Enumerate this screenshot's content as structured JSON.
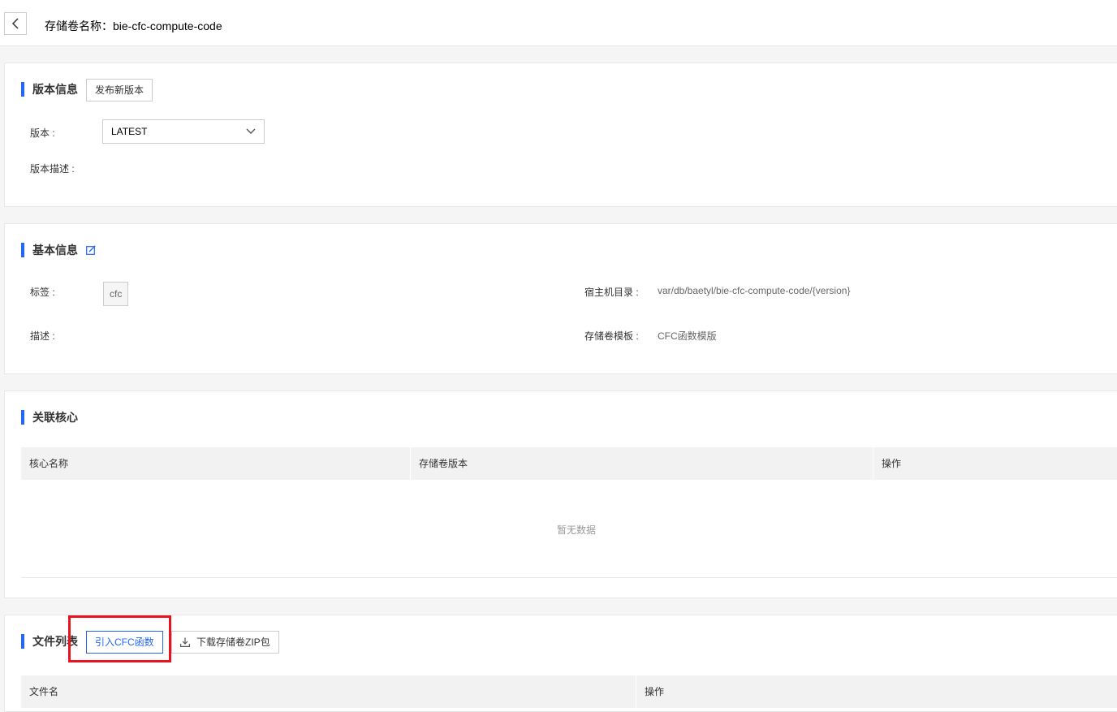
{
  "header": {
    "title": "存储卷名称：bie-cfc-compute-code"
  },
  "version_section": {
    "title": "版本信息",
    "publish_button": "发布新版本",
    "version_label": "版本 :",
    "version_value": "LATEST",
    "description_label": "版本描述 :"
  },
  "basic_section": {
    "title": "基本信息",
    "tag_label": "标签 :",
    "tag_value": "cfc",
    "description_label": "描述 :",
    "host_dir_label": "宿主机目录 :",
    "host_dir_value": "var/db/baetyl/bie-cfc-compute-code/{version}",
    "template_label": "存储卷模板 :",
    "template_value": "CFC函数模版"
  },
  "core_section": {
    "title": "关联核心",
    "columns": [
      "核心名称",
      "存储卷版本",
      "操作"
    ],
    "empty_text": "暂无数据"
  },
  "file_section": {
    "title": "文件列表",
    "import_button": "引入CFC函数",
    "download_button": "下载存储卷ZIP包",
    "columns": [
      "文件名",
      "操作"
    ]
  },
  "colors": {
    "accent": "#2468f2",
    "highlight": "#e8131f"
  }
}
